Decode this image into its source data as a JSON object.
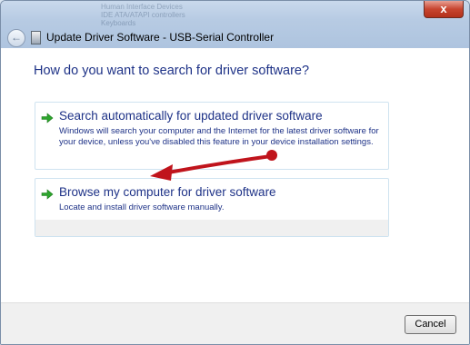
{
  "window": {
    "title": "Update Driver Software - USB-Serial Controller",
    "close_glyph": "x"
  },
  "background_ghost": [
    "Human Interface Devices",
    "IDE ATA/ATAPI controllers",
    "Keyboards"
  ],
  "main": {
    "heading": "How do you want to search for driver software?",
    "options": [
      {
        "title": "Search automatically for updated driver software",
        "description": "Windows will search your computer and the Internet for the latest driver software for your device, unless you've disabled this feature in your device installation settings.",
        "icon": "green-arrow-icon"
      },
      {
        "title": "Browse my computer for driver software",
        "description": "Locate and install driver software manually.",
        "icon": "green-arrow-icon"
      }
    ]
  },
  "footer": {
    "cancel_label": "Cancel"
  },
  "colors": {
    "link_blue": "#1e3287",
    "annotation_red": "#c0141c",
    "arrow_green": "#2da52d"
  }
}
